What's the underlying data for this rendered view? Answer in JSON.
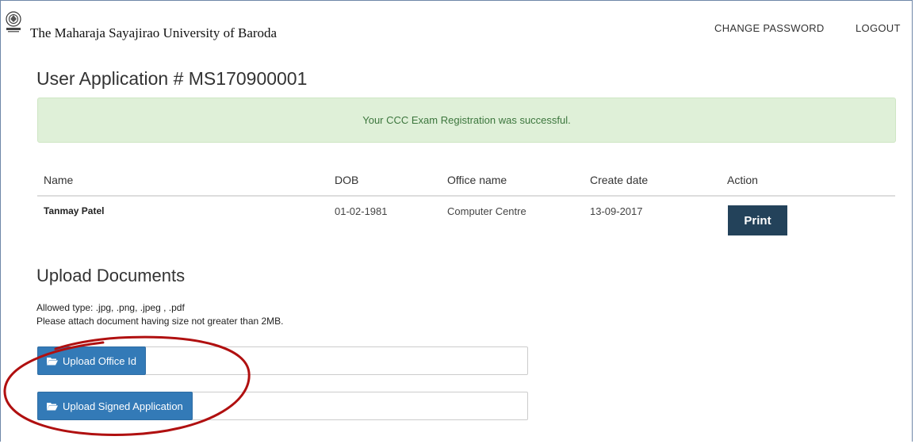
{
  "header": {
    "brand": "The Maharaja Sayajirao University of Baroda",
    "nav": {
      "change_password": "CHANGE PASSWORD",
      "logout": "LOGOUT"
    },
    "logo_icon": "university-seal-icon"
  },
  "page": {
    "title": "User Application # MS170900001",
    "alert": "Your CCC Exam Registration was successful."
  },
  "table": {
    "headers": {
      "name": "Name",
      "dob": "DOB",
      "office": "Office name",
      "date": "Create date",
      "action": "Action"
    },
    "rows": [
      {
        "name": "Tanmay Patel",
        "dob": "01-02-1981",
        "office": "Computer Centre",
        "date": "13-09-2017",
        "action_label": "Print"
      }
    ]
  },
  "uploads": {
    "title": "Upload Documents",
    "allowed": "Allowed type: .jpg, .png, .jpeg , .pdf",
    "size_note": "Please attach document having size not greater than 2MB.",
    "buttons": [
      {
        "label": "Upload Office Id",
        "icon": "folder-open-icon"
      },
      {
        "label": "Upload Signed Application",
        "icon": "folder-open-icon"
      }
    ]
  },
  "colors": {
    "alert_bg": "#dff0d8",
    "alert_text": "#3c763d",
    "print_button": "#23425a",
    "upload_button": "#337ab7",
    "annotation_ellipse": "#b01010"
  }
}
